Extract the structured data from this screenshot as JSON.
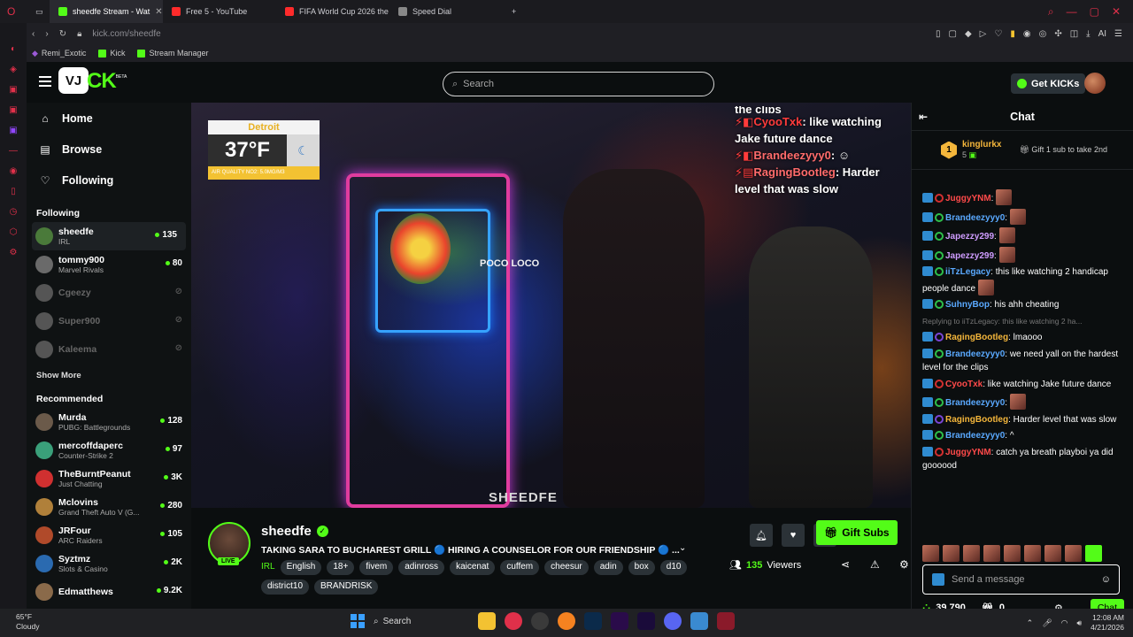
{
  "browser": {
    "tabs": [
      {
        "title": "sheedfe Stream - Wat",
        "color": "#53fc18",
        "active": true
      },
      {
        "title": "Free 5 - YouTube",
        "color": "#ff2b2b",
        "active": false
      },
      {
        "title": "FIFA World Cup 2026 the",
        "color": "#ff2b2b",
        "active": false
      },
      {
        "title": "Speed Dial",
        "color": "#888888",
        "active": false
      }
    ],
    "url_host": "kick.com/",
    "url_path": "sheedfe",
    "bookmarks": [
      "Remi_Exotic",
      "Kick",
      "Stream Manager"
    ],
    "ai_label": "AI"
  },
  "kick": {
    "logo_box": "VJ",
    "logo_text": "CK",
    "logo_beta": "BETA",
    "search_placeholder": "Search",
    "get_kicks": "Get KICKs",
    "nav": [
      {
        "label": "Home",
        "icon": "home-icon"
      },
      {
        "label": "Browse",
        "icon": "browse-icon"
      },
      {
        "label": "Following",
        "icon": "heart-icon"
      }
    ],
    "following_title": "Following",
    "following": [
      {
        "name": "sheedfe",
        "category": "IRL",
        "viewers": "135",
        "color": "#4a7a3a"
      },
      {
        "name": "tommy900",
        "category": "Marvel Rivals",
        "viewers": "80",
        "color": "#6a6a6a"
      },
      {
        "name": "Cgeezy",
        "category": "",
        "viewers": "",
        "color": "#555"
      },
      {
        "name": "Super900",
        "category": "",
        "viewers": "",
        "color": "#555"
      },
      {
        "name": "Kaleema",
        "category": "",
        "viewers": "",
        "color": "#555"
      }
    ],
    "show_more": "Show More",
    "recommended_title": "Recommended",
    "recommended": [
      {
        "name": "Murda",
        "category": "PUBG: Battlegrounds",
        "viewers": "128",
        "color": "#6b5a4a"
      },
      {
        "name": "mercoffdaperc",
        "category": "Counter-Strike 2",
        "viewers": "97",
        "color": "#3aa07a"
      },
      {
        "name": "TheBurntPeanut",
        "category": "Just Chatting",
        "viewers": "3K",
        "color": "#d03030"
      },
      {
        "name": "Mclovins",
        "category": "Grand Theft Auto V (G...",
        "viewers": "280",
        "color": "#b0803a"
      },
      {
        "name": "JRFour",
        "category": "ARC Raiders",
        "viewers": "105",
        "color": "#b04a2a"
      },
      {
        "name": "Syztmz",
        "category": "Slots & Casino",
        "viewers": "2K",
        "color": "#2a6ab0"
      },
      {
        "name": "Edmatthews",
        "category": "",
        "viewers": "9.2K",
        "color": "#8a6a4a"
      }
    ]
  },
  "video": {
    "weather_city": "Detroit",
    "weather_temp": "37°F",
    "weather_aq": "AIR QUALITY NO2: 5.0MG/M3",
    "moon": "☾",
    "poco": "POCO LOCO",
    "overlay_lines": [
      {
        "user": "",
        "text": "the clips"
      },
      {
        "user": "CyooTxk",
        "text": ": like watching Jake future dance"
      },
      {
        "user": "Brandeezyyy0",
        "text": ": ☺"
      },
      {
        "user": "RagingBootleg",
        "text": ": Harder level that was slow"
      }
    ],
    "watermark": "SHEEDFE"
  },
  "stream": {
    "name": "sheedfe",
    "live": "LIVE",
    "title": "TAKING SARA TO BUCHAREST GRILL 🔵 HIRING A COUNSELOR FOR OUR FRIENDSHIP 🔵 ...",
    "category": "IRL",
    "tags": [
      "English",
      "18+",
      "fivem",
      "adinross",
      "kaicenat",
      "cuffem",
      "cheesur",
      "adin",
      "box",
      "d10",
      "district10",
      "BRANDRISK"
    ],
    "gift_subs": "Gift Subs",
    "viewers": "135",
    "viewers_label": "Viewers"
  },
  "chat": {
    "title": "Chat",
    "top_gifter": "kinglurkx",
    "top_gifter_count": "5",
    "gift_cta": "Gift 1 sub to take 2nd",
    "messages": [
      {
        "user": "JuggyYNM",
        "ucolor": "#ff4a4a",
        "text": ":",
        "emote": true
      },
      {
        "user": "Brandeezyyy0",
        "ucolor": "#5aa9ff",
        "text": ":",
        "emote": true
      },
      {
        "user": "Japezzy299",
        "ucolor": "#cf9cff",
        "text": ":",
        "emote": true
      },
      {
        "user": "Japezzy299",
        "ucolor": "#cf9cff",
        "text": ":",
        "emote": true
      },
      {
        "user": "iiTzLegacy",
        "ucolor": "#5aa9ff",
        "text": ": this like watching 2 handicap people dance",
        "emote": true
      },
      {
        "user": "SuhnyBop",
        "ucolor": "#5aa9ff",
        "text": ": his ahh cheating",
        "emote": false
      },
      {
        "reply": "Replying to iiTzLegacy: this like watching 2 ha..."
      },
      {
        "user": "RagingBootleg",
        "ucolor": "#f4b63b",
        "text": ": lmaooo",
        "emote": false
      },
      {
        "user": "Brandeezyyy0",
        "ucolor": "#5aa9ff",
        "text": ": we need yall on the hardest level for the clips",
        "emote": false
      },
      {
        "user": "CyooTxk",
        "ucolor": "#ff4a4a",
        "text": ": like watching Jake future dance",
        "emote": false
      },
      {
        "user": "Brandeezyyy0",
        "ucolor": "#5aa9ff",
        "text": ":",
        "emote": true
      },
      {
        "user": "RagingBootleg",
        "ucolor": "#f4b63b",
        "text": ": Harder level that was slow",
        "emote": false
      },
      {
        "user": "Brandeezyyy0",
        "ucolor": "#5aa9ff",
        "text": ": ^",
        "emote": false
      },
      {
        "user": "JuggyYNM",
        "ucolor": "#ff4a4a",
        "text": ": catch ya breath playboi ya did goooood",
        "emote": false
      }
    ],
    "send_placeholder": "Send a message",
    "points": "39,790",
    "gifts": "0",
    "chat_button": "Chat"
  },
  "taskbar": {
    "temp": "65°F",
    "condition": "Cloudy",
    "search": "Search",
    "time": "12:08 AM",
    "date": "4/21/2026"
  }
}
